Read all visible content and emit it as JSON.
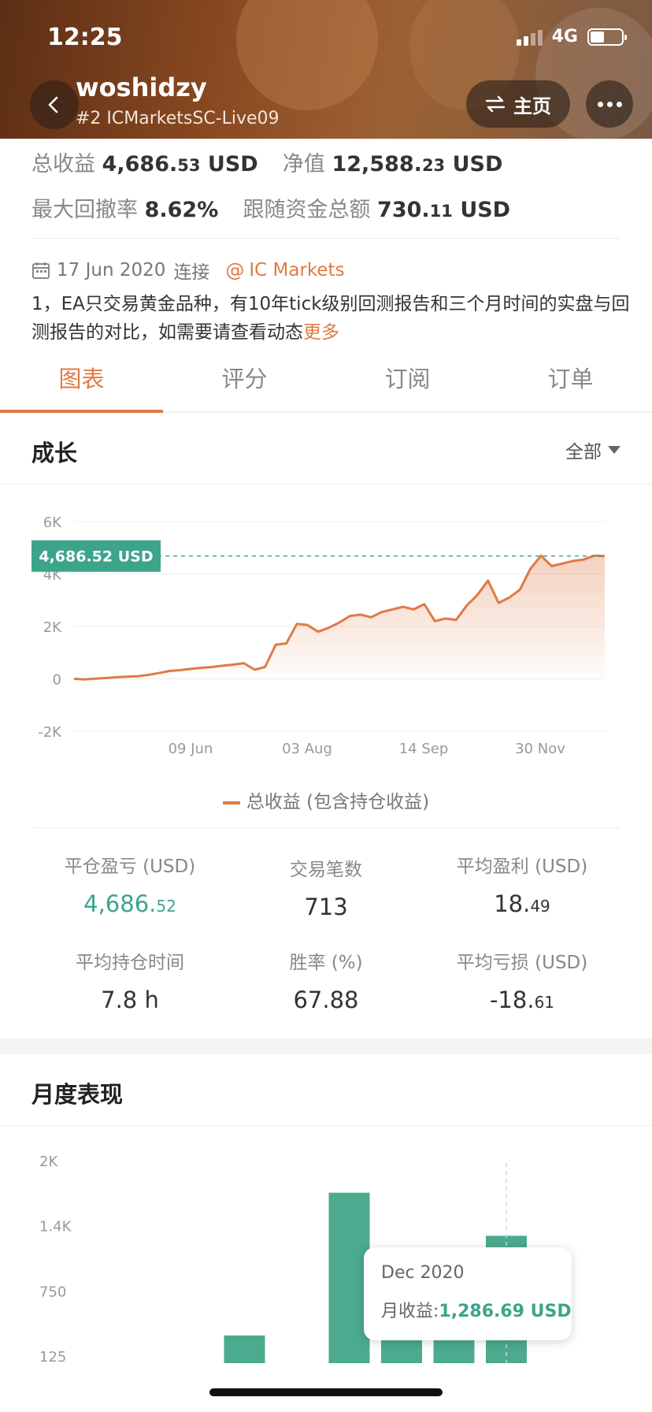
{
  "status_bar": {
    "time": "12:25",
    "network": "4G"
  },
  "header": {
    "account_name": "woshidzy",
    "account_sub": "#2 ICMarketsSC-Live09",
    "home_label": "主页"
  },
  "summary": {
    "total_profit_label": "总收益",
    "total_profit_int": "4,686.",
    "total_profit_dec": "53",
    "total_profit_unit": "USD",
    "equity_label": "净值",
    "equity_int": "12,588.",
    "equity_dec": "23",
    "equity_unit": "USD",
    "max_drawdown_label": "最大回撤率",
    "max_drawdown_value": "8.62%",
    "follow_funds_label": "跟随资金总额",
    "follow_funds_int": "730.",
    "follow_funds_dec": "11",
    "follow_funds_unit": "USD"
  },
  "connection": {
    "date": "17 Jun 2020",
    "connect_label": "连接",
    "broker": "IC Markets",
    "description": "1，EA只交易黄金品种，有10年tick级别回测报告和三个月时间的实盘与回测报告的对比，如需要请查看动态",
    "more_label": "更多"
  },
  "tabs": [
    {
      "label": "图表",
      "active": true
    },
    {
      "label": "评分",
      "active": false
    },
    {
      "label": "订阅",
      "active": false
    },
    {
      "label": "订单",
      "active": false
    }
  ],
  "growth": {
    "title": "成长",
    "range_label": "全部",
    "legend": "总收益 (包含持仓收益)",
    "current_label": "4,686.52 USD"
  },
  "chart_data": [
    {
      "type": "area",
      "title": "成长",
      "x_tick_labels": [
        "09 Jun",
        "03 Aug",
        "14 Sep",
        "30 Nov"
      ],
      "y_tick_labels": [
        "6K",
        "4K",
        "2K",
        "0",
        "-2K"
      ],
      "ylim": [
        -2000,
        6000
      ],
      "grid": true,
      "series": [
        {
          "name": "总收益 (包含持仓收益)",
          "color": "#e07a45",
          "values": [
            0,
            -20,
            10,
            30,
            60,
            80,
            100,
            150,
            220,
            300,
            330,
            380,
            420,
            450,
            500,
            540,
            600,
            350,
            450,
            1300,
            1350,
            2100,
            2050,
            1800,
            1950,
            2150,
            2400,
            2450,
            2350,
            2550,
            2650,
            2750,
            2650,
            2850,
            2200,
            2300,
            2250,
            2800,
            3200,
            3750,
            2900,
            3100,
            3400,
            4200,
            4700,
            4300,
            4400,
            4500,
            4550,
            4700,
            4686.52
          ]
        }
      ],
      "reference_value": 4686.52
    },
    {
      "type": "bar",
      "title": "月度表现",
      "y_tick_labels": [
        "2K",
        "1.4K",
        "750",
        "125"
      ],
      "ylim": [
        125,
        2000
      ],
      "months": 7,
      "values": [
        0,
        330,
        0,
        1700,
        1100,
        1100,
        1286.69
      ],
      "color": "#4caa8e"
    }
  ],
  "metrics": [
    {
      "label": "平仓盈亏 (USD)",
      "value_int": "4,686.",
      "value_dec": "52",
      "green": true
    },
    {
      "label": "交易笔数",
      "value_int": "713",
      "value_dec": "",
      "green": false
    },
    {
      "label": "平均盈利 (USD)",
      "value_int": "18.",
      "value_dec": "49",
      "green": false
    },
    {
      "label": "平均持仓时间",
      "value_int": "7.8 h",
      "value_dec": "",
      "green": false
    },
    {
      "label": "胜率 (%)",
      "value_int": "67.88",
      "value_dec": "",
      "green": false
    },
    {
      "label": "平均亏损 (USD)",
      "value_int": "-18.",
      "value_dec": "61",
      "green": false
    }
  ],
  "monthly": {
    "title": "月度表现",
    "tooltip_title": "Dec 2020",
    "tooltip_label": "月收益:",
    "tooltip_value": "1,286.69 USD"
  },
  "colors": {
    "accent": "#e07a45",
    "positive": "#3ca48b",
    "bar": "#4caa8e"
  }
}
